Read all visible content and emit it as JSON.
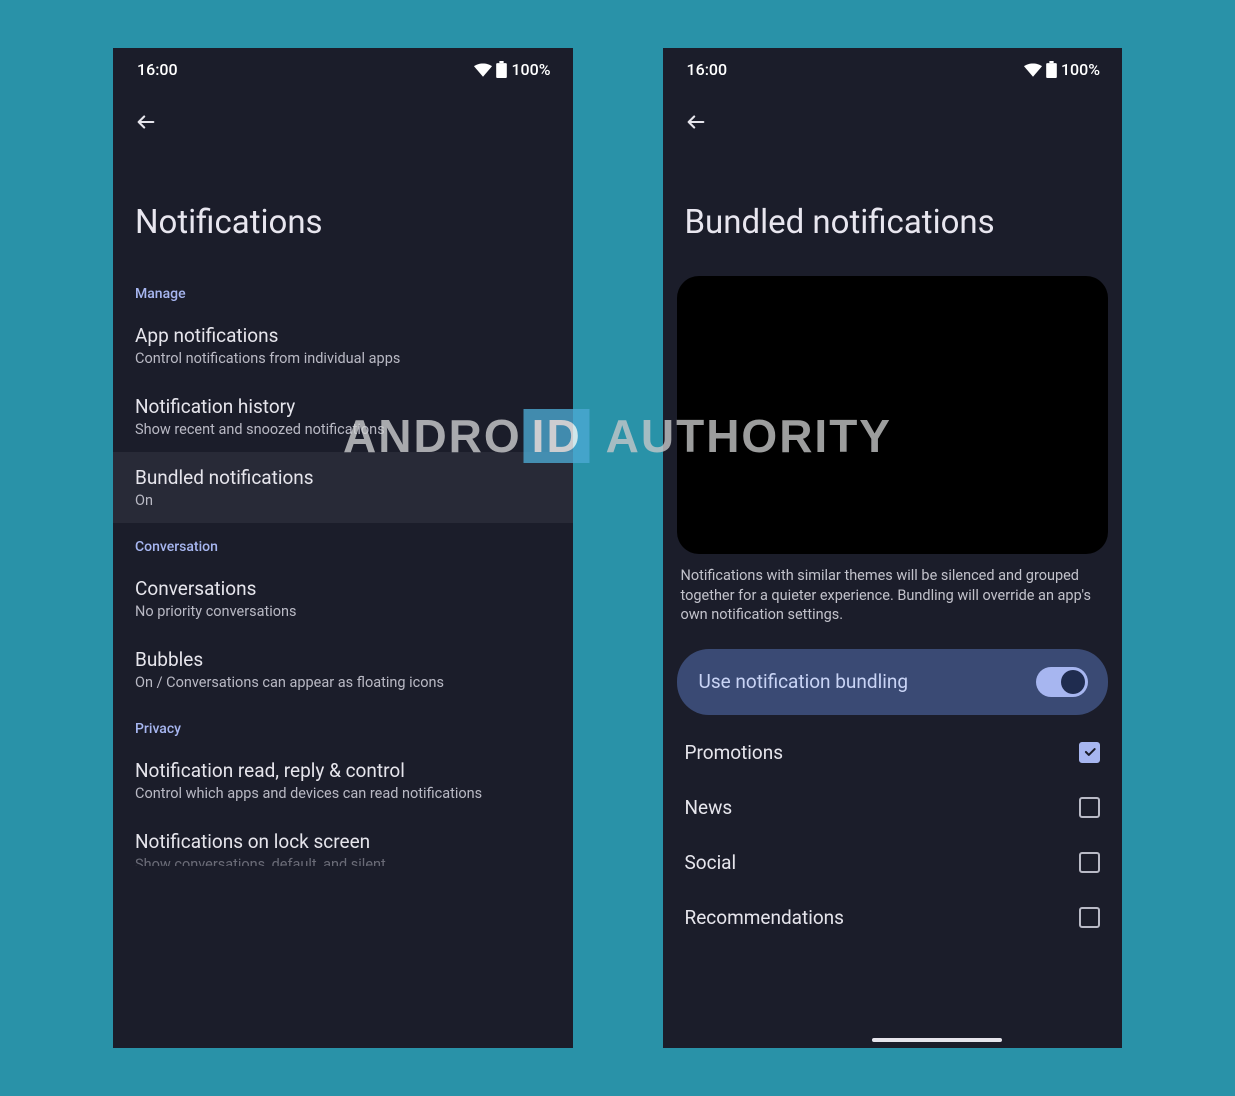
{
  "status": {
    "time": "16:00",
    "battery": "100%"
  },
  "left": {
    "title": "Notifications",
    "sections": [
      {
        "header": "Manage",
        "items": [
          {
            "title": "App notifications",
            "sub": "Control notifications from individual apps",
            "highlight": false
          },
          {
            "title": "Notification history",
            "sub": "Show recent and snoozed notifications",
            "highlight": false
          },
          {
            "title": "Bundled notifications",
            "sub": "On",
            "highlight": true
          }
        ]
      },
      {
        "header": "Conversation",
        "items": [
          {
            "title": "Conversations",
            "sub": "No priority conversations",
            "highlight": false
          },
          {
            "title": "Bubbles",
            "sub": "On / Conversations can appear as floating icons",
            "highlight": false
          }
        ]
      },
      {
        "header": "Privacy",
        "items": [
          {
            "title": "Notification read, reply & control",
            "sub": "Control which apps and devices can read notifications",
            "highlight": false
          },
          {
            "title": "Notifications on lock screen",
            "sub": "Show conversations, default, and silent",
            "highlight": false,
            "cutoff": true
          }
        ]
      }
    ]
  },
  "right": {
    "title": "Bundled notifications",
    "description": "Notifications with similar themes will be silenced and grouped together for a quieter experience. Bundling will override an app's own notification settings.",
    "toggle_label": "Use notification bundling",
    "toggle_on": true,
    "categories": [
      {
        "label": "Promotions",
        "checked": true
      },
      {
        "label": "News",
        "checked": false
      },
      {
        "label": "Social",
        "checked": false
      },
      {
        "label": "Recommendations",
        "checked": false
      }
    ]
  },
  "watermark": {
    "part1": "ANDRO",
    "part2": "ID",
    "part3": "AUTHORITY"
  }
}
